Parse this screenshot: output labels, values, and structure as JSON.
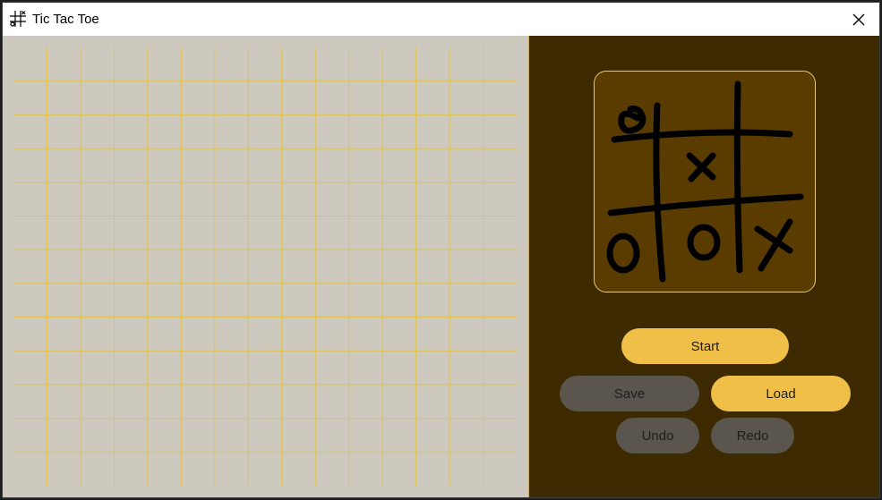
{
  "window": {
    "title": "Tic Tac Toe",
    "icon": "grid-app-icon",
    "close_icon": "close-icon"
  },
  "board": {
    "cols": 15,
    "rows": 13,
    "background": "#cdc9bf",
    "line_color": "#e3c34a"
  },
  "sidebar": {
    "background": "#3d2a00",
    "logo": "tic-tac-toe-logo",
    "buttons": {
      "start": "Start",
      "save": "Save",
      "load": "Load",
      "undo": "Undo",
      "redo": "Redo"
    }
  },
  "colors": {
    "accent": "#f0bf47",
    "disabled": "#5a554d"
  }
}
